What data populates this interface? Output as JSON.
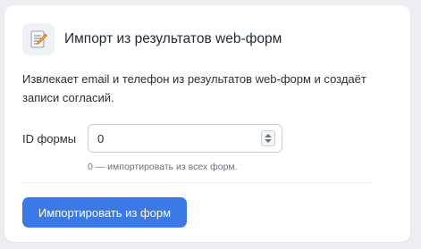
{
  "header": {
    "icon": "memo-icon",
    "title": "Импорт из результатов web-форм"
  },
  "description": "Извлекает email и телефон из результатов web-форм и создаёт записи согласий.",
  "form_id_field": {
    "label": "ID формы",
    "value": "0",
    "hint": "0 — импортировать из всех форм."
  },
  "actions": {
    "import_label": "Импортировать из форм"
  },
  "colors": {
    "accent": "#3b79e6",
    "background": "#eceef1"
  }
}
